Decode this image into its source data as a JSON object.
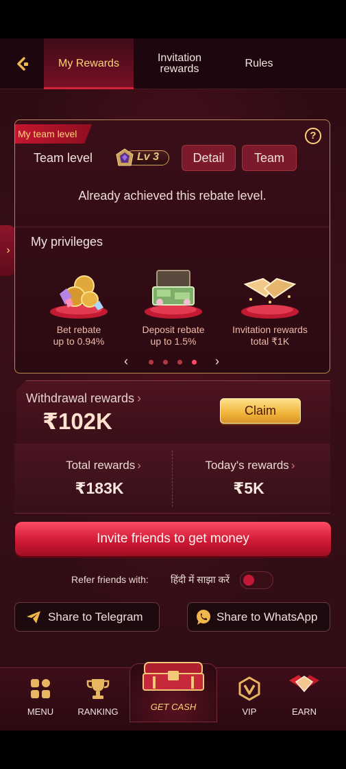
{
  "header": {
    "tabs": [
      {
        "label": "My Rewards",
        "active": true
      },
      {
        "label": "Invitation rewards",
        "active": false
      },
      {
        "label": "Rules",
        "active": false
      }
    ]
  },
  "team": {
    "ribbon": "My team level",
    "label": "Team level",
    "level": "Lv 3",
    "detail_btn": "Detail",
    "team_btn": "Team",
    "achieved_text": "Already achieved this rebate level."
  },
  "privileges": {
    "title": "My privileges",
    "items": [
      {
        "line1": "Bet rebate",
        "line2": "up to 0.94%"
      },
      {
        "line1": "Deposit rebate",
        "line2": "up to 1.5%"
      },
      {
        "line1": "Invitation rewards",
        "line2": "total ₹1K"
      }
    ],
    "carousel_active_index": 3,
    "carousel_count": 4
  },
  "withdrawal": {
    "label": "Withdrawal rewards",
    "amount": "₹102K",
    "claim": "Claim"
  },
  "stats": {
    "total_label": "Total rewards",
    "total_value": "₹183K",
    "today_label": "Today's rewards",
    "today_value": "₹5K"
  },
  "invite": {
    "label": "Invite friends to get money"
  },
  "refer": {
    "label": "Refer friends with:",
    "language": "हिंदी में साझा करें",
    "toggle_on": false
  },
  "share": {
    "telegram": "Share to Telegram",
    "whatsapp": "Share to WhatsApp"
  },
  "nav": {
    "menu": "MENU",
    "ranking": "RANKING",
    "get_cash": "GET CASH",
    "vip": "VIP",
    "earn": "EARN"
  },
  "colors": {
    "accent": "#d01a36",
    "gold": "#ffd27a",
    "background": "#2a0b13"
  }
}
